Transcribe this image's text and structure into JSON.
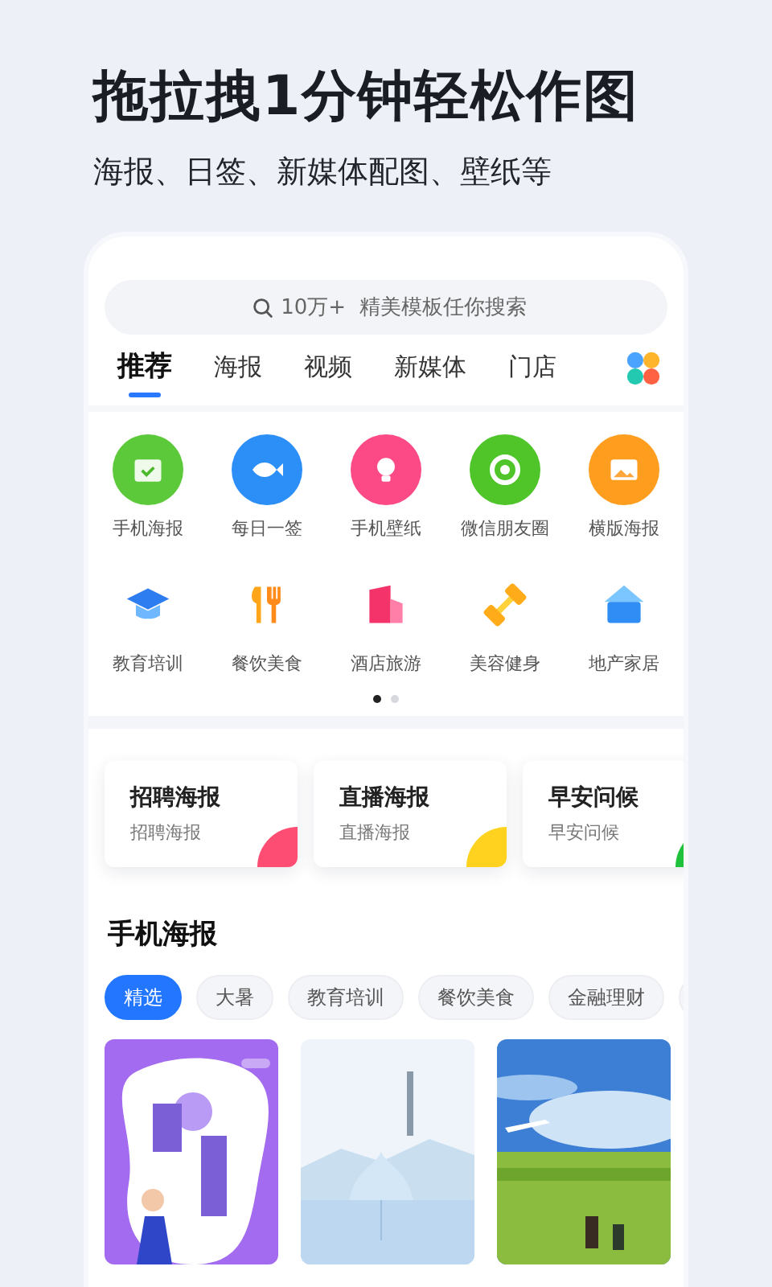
{
  "headline": "拖拉拽1分钟轻松作图",
  "subtitle": "海报、日签、新媒体配图、壁纸等",
  "search": {
    "placeholder": "10万+  精美模板任你搜索"
  },
  "tabs": [
    {
      "label": "推荐",
      "selected": true
    },
    {
      "label": "海报",
      "selected": false
    },
    {
      "label": "视频",
      "selected": false
    },
    {
      "label": "新媒体",
      "selected": false
    },
    {
      "label": "门店",
      "selected": false
    }
  ],
  "categories": [
    {
      "label": "手机海报",
      "kind": "round",
      "color": "#5cc93a"
    },
    {
      "label": "每日一签",
      "kind": "round",
      "color": "#2b8ff7"
    },
    {
      "label": "手机壁纸",
      "kind": "round",
      "color": "#fb4a86"
    },
    {
      "label": "微信朋友圈",
      "kind": "round",
      "color": "#4fc52a"
    },
    {
      "label": "横版海报",
      "kind": "round",
      "color": "#ff9d1e"
    },
    {
      "label": "教育培训",
      "kind": "flat",
      "color": "#2d7cf0"
    },
    {
      "label": "餐饮美食",
      "kind": "flat",
      "color": "#ffa51a"
    },
    {
      "label": "酒店旅游",
      "kind": "flat",
      "color": "#f5336b"
    },
    {
      "label": "美容健身",
      "kind": "flat",
      "color": "#ffab1a"
    },
    {
      "label": "地产家居",
      "kind": "flat",
      "color": "#2f8df5"
    }
  ],
  "pager": [
    {
      "selected": true
    },
    {
      "selected": false
    }
  ],
  "cards": [
    {
      "title": "招聘海报",
      "subtitle": "招聘海报",
      "color": "#fd4d72"
    },
    {
      "title": "直播海报",
      "subtitle": "直播海报",
      "color": "#ffd21f"
    },
    {
      "title": "早安问候",
      "subtitle": "早安问候",
      "color": "#1fc23a"
    }
  ],
  "section": {
    "title": "手机海报"
  },
  "chips": [
    {
      "label": "精选",
      "selected": true
    },
    {
      "label": "大暑",
      "selected": false
    },
    {
      "label": "教育培训",
      "selected": false
    },
    {
      "label": "餐饮美食",
      "selected": false
    },
    {
      "label": "金融理财",
      "selected": false
    }
  ]
}
